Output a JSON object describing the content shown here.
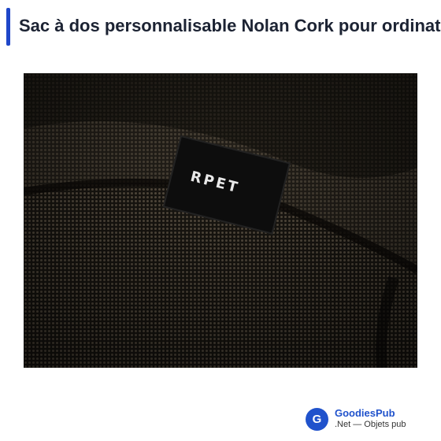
{
  "header": {
    "title": "Sac à dos personnalisable Nolan Cork pour ordinateur portable",
    "accent_color": "#1f47c9"
  },
  "product_image": {
    "label_text": "RPET",
    "description_icon": "fabric-photo"
  },
  "brand": {
    "logo_letter": "G",
    "name": "GoodiesPub",
    "subtitle": ".Net — Objets pub",
    "color": "#2052cc"
  }
}
